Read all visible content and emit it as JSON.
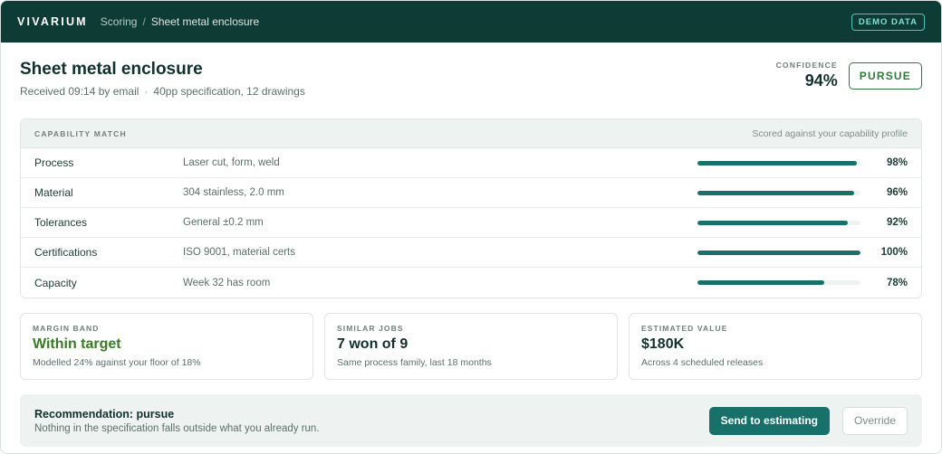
{
  "topbar": {
    "brand": "VIVARIUM",
    "breadcrumb": [
      "Scoring",
      "/",
      "Sheet metal enclosure"
    ],
    "demo_badge": "DEMO DATA"
  },
  "header": {
    "title": "Sheet metal enclosure",
    "received": "Received 09:14 by email",
    "separator": "·",
    "spec": "40pp specification, 12 drawings",
    "confidence_label": "CONFIDENCE",
    "confidence_value": "94%",
    "status_badge": "PURSUE"
  },
  "capability": {
    "label": "CAPABILITY MATCH",
    "note": "Scored against your capability profile",
    "rows": [
      {
        "name": "Process",
        "detail": "Laser cut, form, weld",
        "percent": "98%",
        "fill": 98
      },
      {
        "name": "Material",
        "detail": "304 stainless, 2.0 mm",
        "percent": "96%",
        "fill": 96
      },
      {
        "name": "Tolerances",
        "detail": "General ±0.2 mm",
        "percent": "92%",
        "fill": 92
      },
      {
        "name": "Certifications",
        "detail": "ISO 9001, material certs",
        "percent": "100%",
        "fill": 100
      },
      {
        "name": "Capacity",
        "detail": "Week 32 has room",
        "percent": "78%",
        "fill": 78
      }
    ]
  },
  "stats": [
    {
      "label": "MARGIN BAND",
      "value": "Within target",
      "note": "Modelled 24% against your floor of 18%"
    },
    {
      "label": "SIMILAR JOBS",
      "value": "7 won of 9",
      "note": "Same process family, last 18 months"
    },
    {
      "label": "ESTIMATED VALUE",
      "value": "$180K",
      "note": "Across 4 scheduled releases"
    }
  ],
  "recommendation": {
    "title": "Recommendation: pursue",
    "note": "Nothing in the specification falls outside what you already run.",
    "primary_label": "Send to estimating",
    "secondary_label": "Override"
  },
  "colors": {
    "topbar": "#0f3b36",
    "accent": "#177069",
    "positive": "#2f7a3b"
  }
}
